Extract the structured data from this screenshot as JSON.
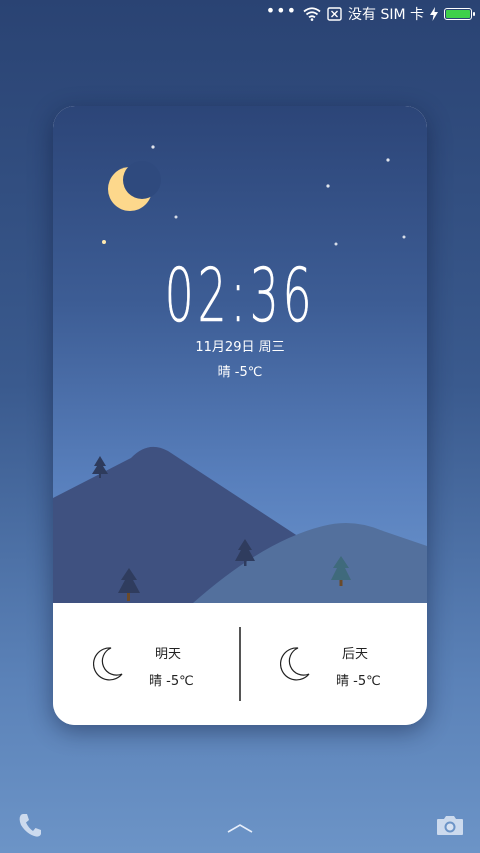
{
  "status_bar": {
    "signal_text": "没有 SIM 卡",
    "battery_color": "#3ed14a"
  },
  "widget": {
    "time": "02:36",
    "date": "11月29日 周三",
    "current_weather": "晴 -5℃",
    "forecast": [
      {
        "day": "明天",
        "condition": "晴 -5℃",
        "icon": "moon-icon"
      },
      {
        "day": "后天",
        "condition": "晴 -5℃",
        "icon": "moon-icon"
      }
    ]
  },
  "colors": {
    "moon": "#fdd88c",
    "mountain_dark": "#3f5180",
    "mountain_light": "#53709d"
  }
}
